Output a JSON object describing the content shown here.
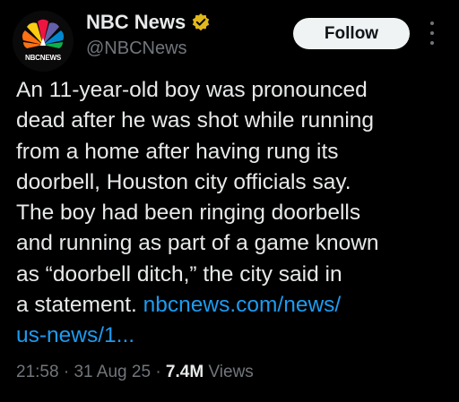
{
  "author": {
    "display_name": "NBC News",
    "handle": "@NBCNews",
    "avatar_label": "NBCNEWS",
    "avatar_icon": "nbc-peacock-logo",
    "verified_icon": "gold-verified-badge",
    "verified_color": "#e2b719"
  },
  "actions": {
    "follow_label": "Follow",
    "more_icon": "vertical-ellipsis-icon"
  },
  "post": {
    "text": "An 11-year-old boy was pronounced\ndead after he was shot while running\nfrom a home after having rung its\ndoorbell, Houston city officials say.\nThe boy had been ringing doorbells\nand running as part of a game known\nas “doorbell ditch,” the city said in\na statement. ",
    "link_text": "nbcnews.com/news/\nus-news/1...",
    "link_color": "#1d9bf0"
  },
  "meta": {
    "time": "21:58",
    "separator": "·",
    "date": "31 Aug 25",
    "views_count": "7.4M",
    "views_label": "Views"
  },
  "colors": {
    "background": "#000000",
    "text_primary": "#e7e9ea",
    "text_secondary": "#71767b",
    "button_bg": "#eff3f4"
  }
}
